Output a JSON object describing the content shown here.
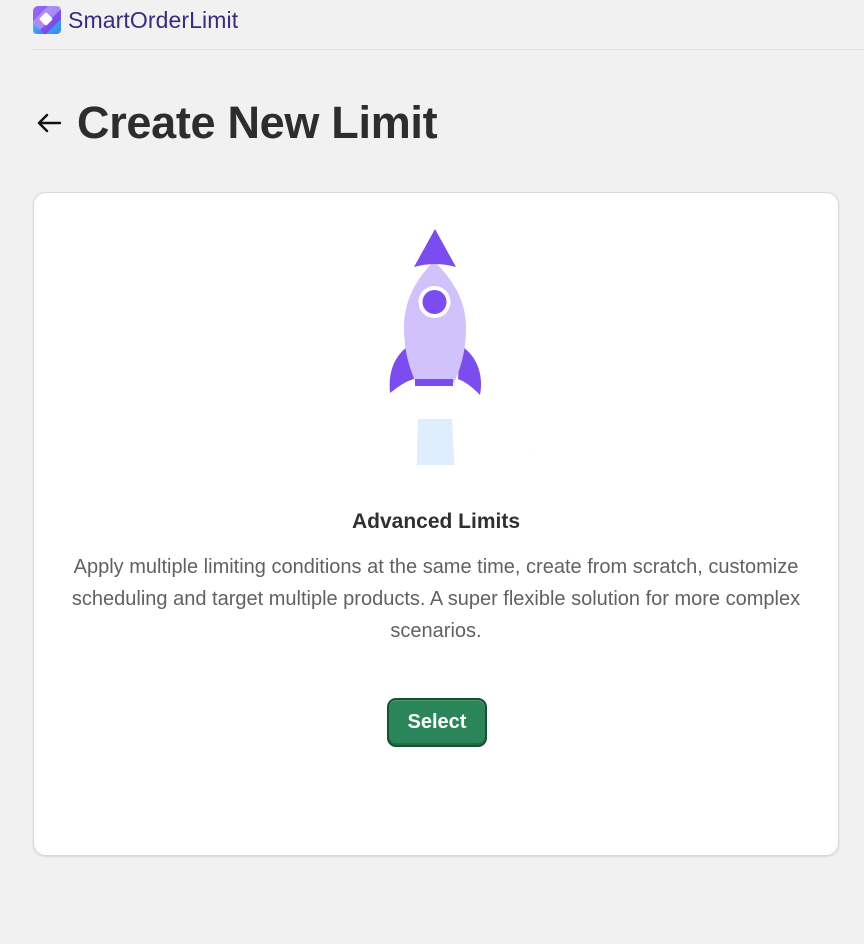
{
  "brand": {
    "name_part1": "Smart",
    "name_part2": "OrderLimit",
    "logo_icon": "smartorderlimit-logo-icon",
    "colors": {
      "logo_purple": "#7b4cf0",
      "logo_blue": "#3fa4f5",
      "text": "#3b2a84"
    }
  },
  "header": {
    "back_icon": "arrow-left-icon",
    "title": "Create New Limit"
  },
  "card": {
    "illustration": "rocket-illustration",
    "title": "Advanced Limits",
    "description": "Apply multiple limiting conditions at the same time, create from scratch, customize scheduling and target multiple products. A super flexible solution for more complex scenarios.",
    "select_label": "Select",
    "colors": {
      "button_bg": "#2a8558",
      "rocket_body": "#d2c2fb",
      "rocket_accent": "#7b4cf0",
      "rocket_flame": "#dfeefc"
    }
  }
}
